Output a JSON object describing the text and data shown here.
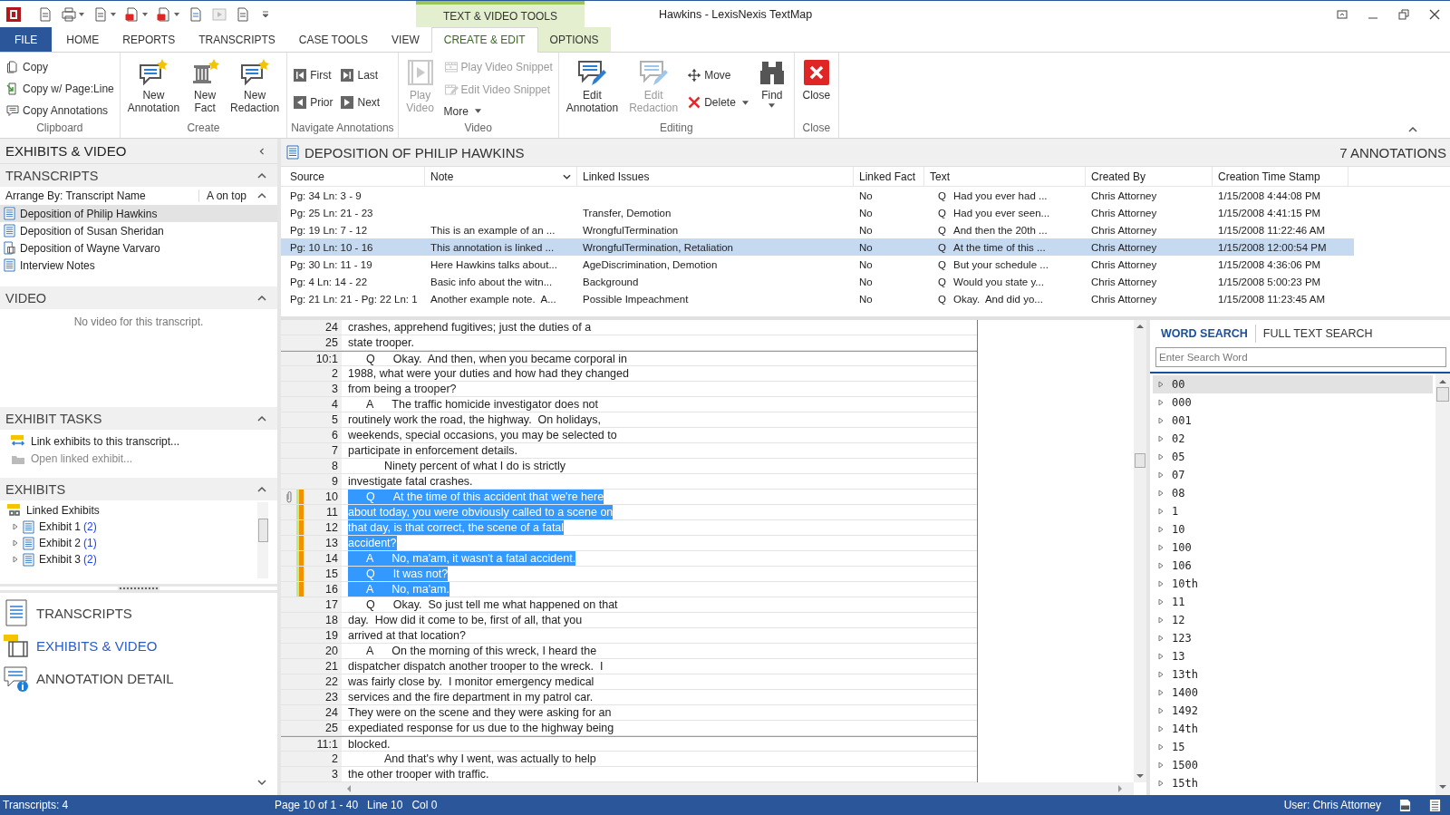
{
  "window": {
    "title": "Hawkins - LexisNexis TextMap",
    "contextual_tab": "TEXT & VIDEO TOOLS"
  },
  "menu_tabs": [
    {
      "label": "FILE",
      "kind": "file",
      "selected": false,
      "contextual": false
    },
    {
      "label": "HOME",
      "kind": "tab",
      "selected": false,
      "contextual": false
    },
    {
      "label": "REPORTS",
      "kind": "tab",
      "selected": false,
      "contextual": false
    },
    {
      "label": "TRANSCRIPTS",
      "kind": "tab",
      "selected": false,
      "contextual": false
    },
    {
      "label": "CASE TOOLS",
      "kind": "tab",
      "selected": false,
      "contextual": false
    },
    {
      "label": "VIEW",
      "kind": "tab",
      "selected": false,
      "contextual": false
    },
    {
      "label": "CREATE & EDIT",
      "kind": "tab",
      "selected": true,
      "contextual": true
    },
    {
      "label": "OPTIONS",
      "kind": "tab",
      "selected": false,
      "contextual": true
    }
  ],
  "ribbon": {
    "groups": [
      {
        "label": "Clipboard",
        "items": [
          {
            "label": "Copy",
            "kind": "small",
            "disabled": false,
            "dropdown": false
          },
          {
            "label": "Copy w/ Page:Line",
            "kind": "small",
            "disabled": false,
            "dropdown": false
          },
          {
            "label": "Copy Annotations",
            "kind": "small",
            "disabled": false,
            "dropdown": false
          }
        ]
      },
      {
        "label": "Create",
        "items": [
          {
            "label": "New Annotation",
            "kind": "large",
            "disabled": false,
            "dropdown": false
          },
          {
            "label": "New Fact",
            "kind": "large",
            "disabled": false,
            "dropdown": false
          },
          {
            "label": "New Redaction",
            "kind": "large",
            "disabled": false,
            "dropdown": false
          }
        ]
      },
      {
        "label": "Navigate Annotations",
        "items": [
          {
            "label": "First",
            "kind": "small",
            "disabled": false,
            "dropdown": false
          },
          {
            "label": "Prior",
            "kind": "small",
            "disabled": false,
            "dropdown": false
          },
          {
            "label": "Last",
            "kind": "small",
            "disabled": false,
            "dropdown": false
          },
          {
            "label": "Next",
            "kind": "small",
            "disabled": false,
            "dropdown": false
          }
        ]
      },
      {
        "label": "Video",
        "items": [
          {
            "label": "Play Video",
            "kind": "large",
            "disabled": true,
            "dropdown": false
          },
          {
            "label": "Play Video Snippet",
            "kind": "small",
            "disabled": true,
            "dropdown": false
          },
          {
            "label": "Edit Video Snippet",
            "kind": "small",
            "disabled": true,
            "dropdown": false
          },
          {
            "label": "More",
            "kind": "small",
            "disabled": false,
            "dropdown": true
          }
        ]
      },
      {
        "label": "Editing",
        "items": [
          {
            "label": "Edit Annotation",
            "kind": "large",
            "disabled": false,
            "dropdown": false
          },
          {
            "label": "Edit Redaction",
            "kind": "large",
            "disabled": true,
            "dropdown": false
          },
          {
            "label": "Move",
            "kind": "small",
            "disabled": false,
            "dropdown": false
          },
          {
            "label": "Delete",
            "kind": "small",
            "disabled": false,
            "dropdown": true
          },
          {
            "label": "Find",
            "kind": "large",
            "disabled": false,
            "dropdown": true
          }
        ]
      },
      {
        "label": "Close",
        "items": [
          {
            "label": "Close",
            "kind": "large",
            "disabled": false,
            "dropdown": false
          }
        ]
      }
    ]
  },
  "sidebar": {
    "title": "EXHIBITS & VIDEO",
    "transcripts": {
      "title": "TRANSCRIPTS",
      "arrange_by": "Arrange By: Transcript Name",
      "sort": "A on top",
      "items": [
        {
          "label": "Deposition of Philip Hawkins",
          "kind": "text",
          "selected": true
        },
        {
          "label": "Deposition of Susan Sheridan",
          "kind": "text",
          "selected": false
        },
        {
          "label": "Deposition of Wayne Varvaro",
          "kind": "video",
          "selected": false
        },
        {
          "label": "Interview Notes",
          "kind": "text",
          "selected": false
        }
      ]
    },
    "video": {
      "title": "VIDEO",
      "message": "No video for this transcript."
    },
    "exhibit_tasks": {
      "title": "EXHIBIT TASKS",
      "items": [
        {
          "label": "Link exhibits to this transcript...",
          "disabled": false
        },
        {
          "label": "Open linked exhibit...",
          "disabled": true
        }
      ]
    },
    "exhibits": {
      "title": "EXHIBITS",
      "tree": [
        {
          "label": "Linked Exhibits",
          "children": [
            {
              "label": "Exhibit 1",
              "count": "(2)",
              "expanded": false
            },
            {
              "label": "Exhibit 2",
              "count": "(1)",
              "expanded": false
            },
            {
              "label": "Exhibit 3",
              "count": "(2)",
              "expanded": false
            }
          ]
        }
      ]
    },
    "nav": [
      {
        "label": "TRANSCRIPTS",
        "selected": false
      },
      {
        "label": "EXHIBITS & VIDEO",
        "selected": true
      },
      {
        "label": "ANNOTATION DETAIL",
        "selected": false
      }
    ]
  },
  "document": {
    "title": "DEPOSITION OF PHILIP HAWKINS",
    "annotation_count": "7 ANNOTATIONS"
  },
  "table": {
    "columns": [
      "Source",
      "Note",
      "Linked Issues",
      "Linked Fact",
      "Text",
      "Created By",
      "Creation Time Stamp"
    ],
    "rows": [
      {
        "source": "Pg: 34 Ln: 3 - 9",
        "note": "",
        "linked_issues": "",
        "linked_fact": "No",
        "speaker": "Q",
        "text": "Had you ever had ...",
        "created_by": "Chris Attorney",
        "timestamp": "1/15/2008 4:44:08 PM",
        "selected": false
      },
      {
        "source": "Pg: 25 Ln: 21 - 23",
        "note": "",
        "linked_issues": "Transfer, Demotion",
        "linked_fact": "No",
        "speaker": "Q",
        "text": "Had you ever seen...",
        "created_by": "Chris Attorney",
        "timestamp": "1/15/2008 4:41:15 PM",
        "selected": false
      },
      {
        "source": "Pg: 19 Ln: 7 - 12",
        "note": "This is an example of an ...",
        "linked_issues": "WrongfulTermination",
        "linked_fact": "No",
        "speaker": "Q",
        "text": "And then the 20th ...",
        "created_by": "Chris Attorney",
        "timestamp": "1/15/2008 11:22:46 AM",
        "selected": false
      },
      {
        "source": "Pg: 10 Ln: 10 - 16",
        "note": "This annotation is linked ...",
        "linked_issues": "WrongfulTermination, Retaliation",
        "linked_fact": "No",
        "speaker": "Q",
        "text": "At the time of this ...",
        "created_by": "Chris Attorney",
        "timestamp": "1/15/2008 12:00:54 PM",
        "selected": true
      },
      {
        "source": "Pg: 30 Ln: 11 - 19",
        "note": "Here Hawkins talks about...",
        "linked_issues": "AgeDiscrimination, Demotion",
        "linked_fact": "No",
        "speaker": "Q",
        "text": "But your schedule ...",
        "created_by": "Chris Attorney",
        "timestamp": "1/15/2008 4:36:06 PM",
        "selected": false
      },
      {
        "source": "Pg: 4 Ln: 14 - 22",
        "note": "Basic info about the witn...",
        "linked_issues": "Background",
        "linked_fact": "No",
        "speaker": "Q",
        "text": "Would you state y...",
        "created_by": "Chris Attorney",
        "timestamp": "1/15/2008 5:00:23 PM",
        "selected": false
      },
      {
        "source": "Pg: 21 Ln: 21 - Pg: 22 Ln: 1",
        "note": "Another example note.  A...",
        "linked_issues": "Possible Impeachment",
        "linked_fact": "No",
        "speaker": "Q",
        "text": "Okay.  And did yo...",
        "created_by": "Chris Attorney",
        "timestamp": "1/15/2008 11:23:45 AM",
        "selected": false
      }
    ]
  },
  "transcript": {
    "lines": [
      {
        "number": "24",
        "kind": "plain",
        "text": "crashes, apprehend fugitives; just the duties of a",
        "highlighted": false,
        "annotated": false,
        "attachment": false,
        "page_start": false
      },
      {
        "number": "25",
        "kind": "plain",
        "text": "state trooper.",
        "highlighted": false,
        "annotated": false,
        "attachment": false,
        "page_start": false
      },
      {
        "number": "10:1",
        "kind": "turn",
        "speaker": "Q",
        "text": "Okay.  And then, when you became corporal in",
        "highlighted": false,
        "annotated": false,
        "attachment": false,
        "page_start": true
      },
      {
        "number": "2",
        "kind": "plain",
        "text": "1988, what were your duties and how had they changed",
        "highlighted": false,
        "annotated": false,
        "attachment": false,
        "page_start": false
      },
      {
        "number": "3",
        "kind": "plain",
        "text": "from being a trooper?",
        "highlighted": false,
        "annotated": false,
        "attachment": false,
        "page_start": false
      },
      {
        "number": "4",
        "kind": "turn",
        "speaker": "A",
        "text": "The traffic homicide investigator does not",
        "highlighted": false,
        "annotated": false,
        "attachment": false,
        "page_start": false
      },
      {
        "number": "5",
        "kind": "plain",
        "text": "routinely work the road, the highway.  On holidays,",
        "highlighted": false,
        "annotated": false,
        "attachment": false,
        "page_start": false
      },
      {
        "number": "6",
        "kind": "plain",
        "text": "weekends, special occasions, you may be selected to",
        "highlighted": false,
        "annotated": false,
        "attachment": false,
        "page_start": false
      },
      {
        "number": "7",
        "kind": "plain",
        "text": "participate in enforcement details.",
        "highlighted": false,
        "annotated": false,
        "attachment": false,
        "page_start": false
      },
      {
        "number": "8",
        "kind": "paragraph",
        "text": "Ninety percent of what I do is strictly",
        "highlighted": false,
        "annotated": false,
        "attachment": false,
        "page_start": false
      },
      {
        "number": "9",
        "kind": "plain",
        "text": "investigate fatal crashes.",
        "highlighted": false,
        "annotated": false,
        "attachment": false,
        "page_start": false
      },
      {
        "number": "10",
        "kind": "turn",
        "speaker": "Q",
        "text": "At the time of this accident that we're here",
        "highlighted": true,
        "annotated": true,
        "attachment": true,
        "page_start": false
      },
      {
        "number": "11",
        "kind": "plain",
        "text": "about today, you were obviously called to a scene on",
        "highlighted": true,
        "annotated": true,
        "attachment": false,
        "page_start": false
      },
      {
        "number": "12",
        "kind": "plain",
        "text": "that day, is that correct, the scene of a fatal",
        "highlighted": true,
        "annotated": true,
        "attachment": false,
        "page_start": false
      },
      {
        "number": "13",
        "kind": "plain",
        "text": "accident?",
        "highlighted": true,
        "annotated": true,
        "attachment": false,
        "page_start": false
      },
      {
        "number": "14",
        "kind": "turn",
        "speaker": "A",
        "text": "No, ma'am, it wasn't a fatal accident.",
        "highlighted": true,
        "annotated": true,
        "attachment": false,
        "page_start": false
      },
      {
        "number": "15",
        "kind": "turn",
        "speaker": "Q",
        "text": "It was not?",
        "highlighted": true,
        "annotated": true,
        "attachment": false,
        "page_start": false
      },
      {
        "number": "16",
        "kind": "turn",
        "speaker": "A",
        "text": "No, ma'am.",
        "highlighted": true,
        "annotated": true,
        "attachment": false,
        "page_start": false
      },
      {
        "number": "17",
        "kind": "turn",
        "speaker": "Q",
        "text": "Okay.  So just tell me what happened on that",
        "highlighted": false,
        "annotated": false,
        "attachment": false,
        "page_start": false
      },
      {
        "number": "18",
        "kind": "plain",
        "text": "day.  How did it come to be, first of all, that you",
        "highlighted": false,
        "annotated": false,
        "attachment": false,
        "page_start": false
      },
      {
        "number": "19",
        "kind": "plain",
        "text": "arrived at that location?",
        "highlighted": false,
        "annotated": false,
        "attachment": false,
        "page_start": false
      },
      {
        "number": "20",
        "kind": "turn",
        "speaker": "A",
        "text": "On the morning of this wreck, I heard the",
        "highlighted": false,
        "annotated": false,
        "attachment": false,
        "page_start": false
      },
      {
        "number": "21",
        "kind": "plain",
        "text": "dispatcher dispatch another trooper to the wreck.  I",
        "highlighted": false,
        "annotated": false,
        "attachment": false,
        "page_start": false
      },
      {
        "number": "22",
        "kind": "plain",
        "text": "was fairly close by.  I monitor emergency medical",
        "highlighted": false,
        "annotated": false,
        "attachment": false,
        "page_start": false
      },
      {
        "number": "23",
        "kind": "plain",
        "text": "services and the fire department in my patrol car.",
        "highlighted": false,
        "annotated": false,
        "attachment": false,
        "page_start": false
      },
      {
        "number": "24",
        "kind": "plain",
        "text": "They were on the scene and they were asking for an",
        "highlighted": false,
        "annotated": false,
        "attachment": false,
        "page_start": false
      },
      {
        "number": "25",
        "kind": "plain",
        "text": "expediated response for us due to the highway being",
        "highlighted": false,
        "annotated": false,
        "attachment": false,
        "page_start": false
      },
      {
        "number": "11:1",
        "kind": "plain",
        "text": "blocked.",
        "highlighted": false,
        "annotated": false,
        "attachment": false,
        "page_start": true
      },
      {
        "number": "2",
        "kind": "paragraph",
        "text": "And that's why I went, was actually to help",
        "highlighted": false,
        "annotated": false,
        "attachment": false,
        "page_start": false
      },
      {
        "number": "3",
        "kind": "plain",
        "text": "the other trooper with traffic.",
        "highlighted": false,
        "annotated": false,
        "attachment": false,
        "page_start": false
      }
    ]
  },
  "search": {
    "tabs": [
      {
        "label": "WORD SEARCH",
        "selected": true
      },
      {
        "label": "FULL TEXT SEARCH",
        "selected": false
      }
    ],
    "placeholder": "Enter Search Word",
    "words": [
      {
        "label": "00",
        "selected": true
      },
      {
        "label": "000",
        "selected": false
      },
      {
        "label": "001",
        "selected": false
      },
      {
        "label": "02",
        "selected": false
      },
      {
        "label": "05",
        "selected": false
      },
      {
        "label": "07",
        "selected": false
      },
      {
        "label": "08",
        "selected": false
      },
      {
        "label": "1",
        "selected": false
      },
      {
        "label": "10",
        "selected": false
      },
      {
        "label": "100",
        "selected": false
      },
      {
        "label": "106",
        "selected": false
      },
      {
        "label": "10th",
        "selected": false
      },
      {
        "label": "11",
        "selected": false
      },
      {
        "label": "12",
        "selected": false
      },
      {
        "label": "123",
        "selected": false
      },
      {
        "label": "13",
        "selected": false
      },
      {
        "label": "13th",
        "selected": false
      },
      {
        "label": "1400",
        "selected": false
      },
      {
        "label": "1492",
        "selected": false
      },
      {
        "label": "14th",
        "selected": false
      },
      {
        "label": "15",
        "selected": false
      },
      {
        "label": "1500",
        "selected": false
      },
      {
        "label": "15th",
        "selected": false
      }
    ]
  },
  "status_bar": {
    "transcripts": "Transcripts: 4",
    "page": "Page 10 of 1 - 40",
    "line": "Line 10",
    "column": "Col 0",
    "user": "User: Chris Attorney"
  }
}
